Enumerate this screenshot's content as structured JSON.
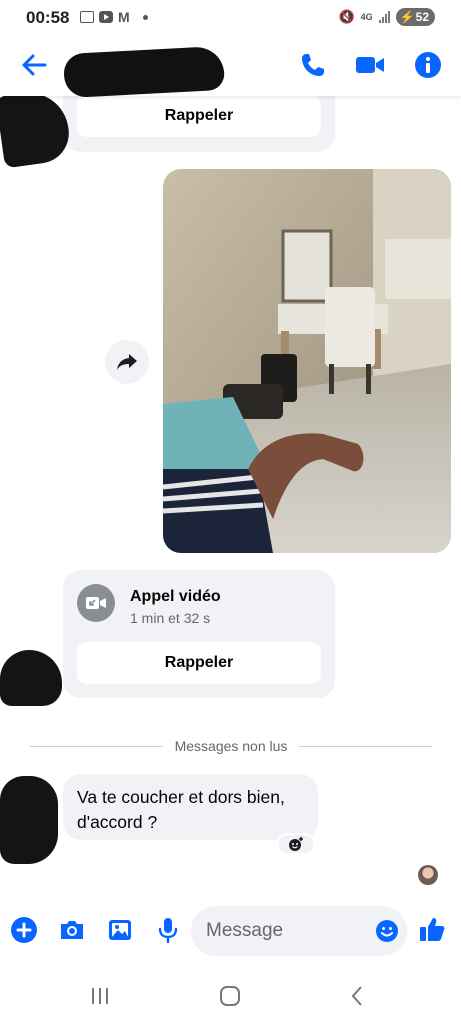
{
  "status_bar": {
    "time": "00:58",
    "network": "4G",
    "battery": "52"
  },
  "colors": {
    "accent": "#0866ff",
    "bubble": "#f0f2f5",
    "secondary_text": "#65676b"
  },
  "header": {
    "icons": [
      "back-arrow-icon",
      "phone-icon",
      "video-camera-icon",
      "info-icon"
    ]
  },
  "messages": {
    "first_call": {
      "button": "Rappeler"
    },
    "second_call": {
      "title": "Appel vidéo",
      "duration": "1 min et 32 s",
      "button": "Rappeler"
    },
    "divider": "Messages non lus",
    "text_message": "Va te coucher et dors bien, d'accord ?"
  },
  "composer": {
    "placeholder": "Message",
    "icons": [
      "plus-icon",
      "camera-icon",
      "gallery-icon",
      "microphone-icon",
      "emoji-icon",
      "thumbs-up-icon"
    ]
  }
}
